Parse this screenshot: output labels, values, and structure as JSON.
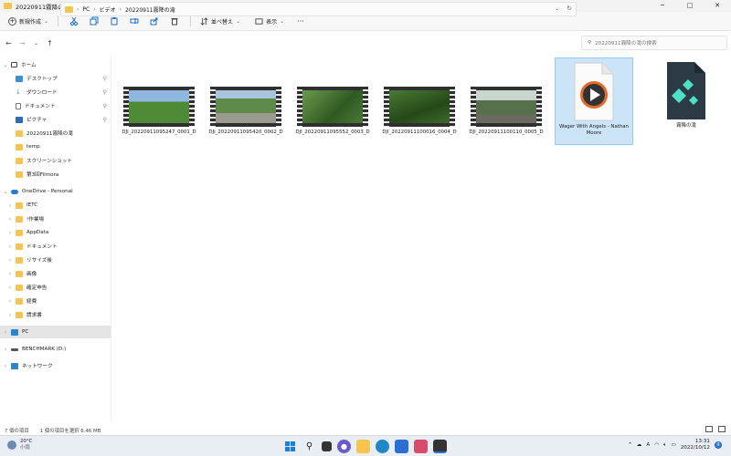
{
  "window": {
    "title": "20220911霧降の滝",
    "min": "─",
    "max": "□",
    "close": "✕"
  },
  "toolbar": {
    "new_label": "新規作成",
    "sort_label": "並べ替え",
    "view_label": "表示",
    "more": "···"
  },
  "address": {
    "parts": [
      "PC",
      "ビデオ",
      "20220911霧降の滝"
    ]
  },
  "search": {
    "placeholder": "20220911霧降の滝の検索"
  },
  "sidebar": {
    "home": "ホーム",
    "quick": [
      "デスクトップ",
      "ダウンロード",
      "ドキュメント",
      "ピクチャ",
      "20220911霧降の滝",
      "temp",
      "スクリーンショット",
      "第3回Filmora"
    ],
    "onedrive": "OneDrive - Personal",
    "onedrive_items": [
      "IETC",
      "!作業場",
      "AppData",
      "ドキュメント",
      "リサイズ後",
      "画像",
      "確定申告",
      "経費",
      "請求書"
    ],
    "pc": "PC",
    "drive": "BENCHMARK (D:)",
    "network": "ネットワーク"
  },
  "files": [
    {
      "name": "DJI_20220911095247_0001_D",
      "color": "#5a8c3e"
    },
    {
      "name": "DJI_20220911095420_0002_D",
      "color": "#7a9a6a"
    },
    {
      "name": "DJI_20220911095552_0003_D",
      "color": "#3f6e2e"
    },
    {
      "name": "DJI_20220911100016_0004_D",
      "color": "#355a28"
    },
    {
      "name": "DJI_20220911100110_0005_D",
      "color": "#4d6b45"
    },
    {
      "name": "Wager With Angels - Nathan Moore"
    },
    {
      "name": "霧降の滝"
    }
  ],
  "status": {
    "count": "7 個の項目",
    "selected": "1 個の項目を選択  6.46 MB"
  },
  "taskbar": {
    "temp": "20°C",
    "weather": "小雨",
    "time": "13:31",
    "date": "2022/10/12",
    "notif": "9",
    "ime": "A"
  }
}
